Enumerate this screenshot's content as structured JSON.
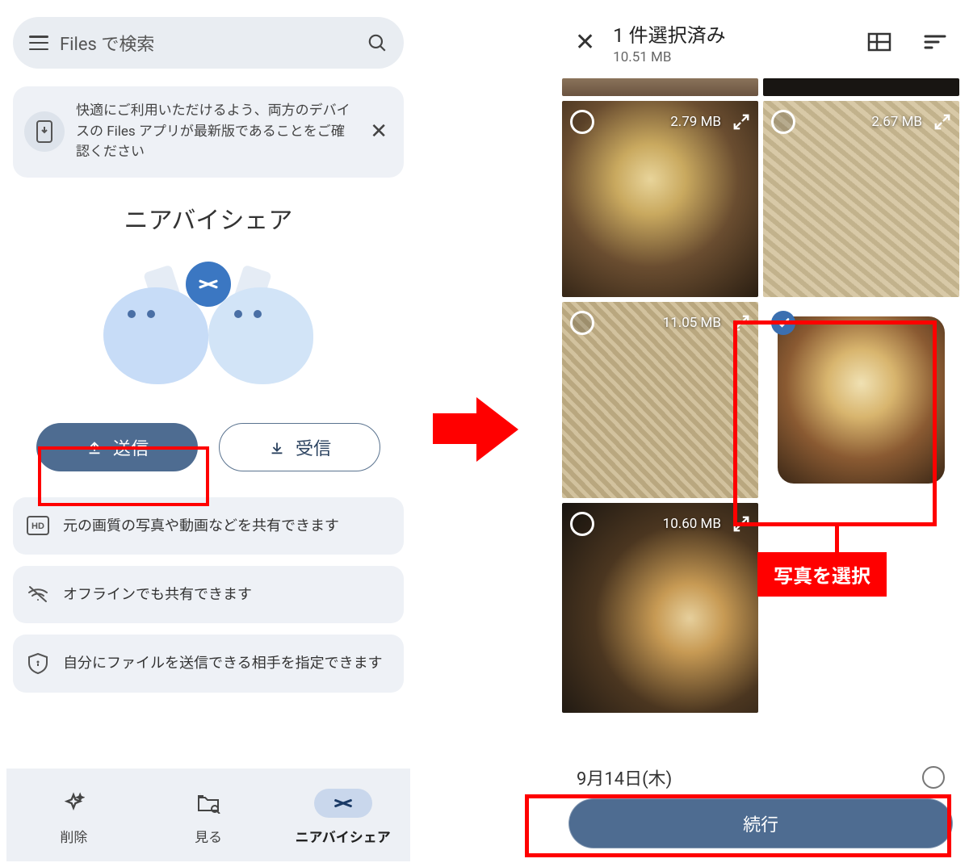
{
  "left": {
    "search_placeholder": "Files で検索",
    "notice": "快適にご利用いただけるよう、両方のデバイスの Files アプリが最新版であることをご確認ください",
    "title": "ニアバイシェア",
    "send_label": "送信",
    "receive_label": "受信",
    "info1": "元の画質の写真や動画などを共有できます",
    "info2": "オフラインでも共有できます",
    "info3": "自分にファイルを送信できる相手を指定できます",
    "nav": {
      "clean": "削除",
      "browse": "見る",
      "share": "ニアバイシェア"
    }
  },
  "right": {
    "header_title": "1 件選択済み",
    "header_sub": "10.51 MB",
    "thumbs": [
      {
        "size": "2.79 MB",
        "style": "food",
        "selected": false
      },
      {
        "size": "2.67 MB",
        "style": "noodle",
        "selected": false
      },
      {
        "size": "11.05 MB",
        "style": "noodle2",
        "selected": false
      },
      {
        "size": "",
        "style": "thumb",
        "selected": true
      },
      {
        "size": "10.60 MB",
        "style": "food",
        "selected": false,
        "half": true
      }
    ],
    "date_label": "9月14日(木)",
    "continue_label": "続行",
    "callout": "写真を選択"
  }
}
